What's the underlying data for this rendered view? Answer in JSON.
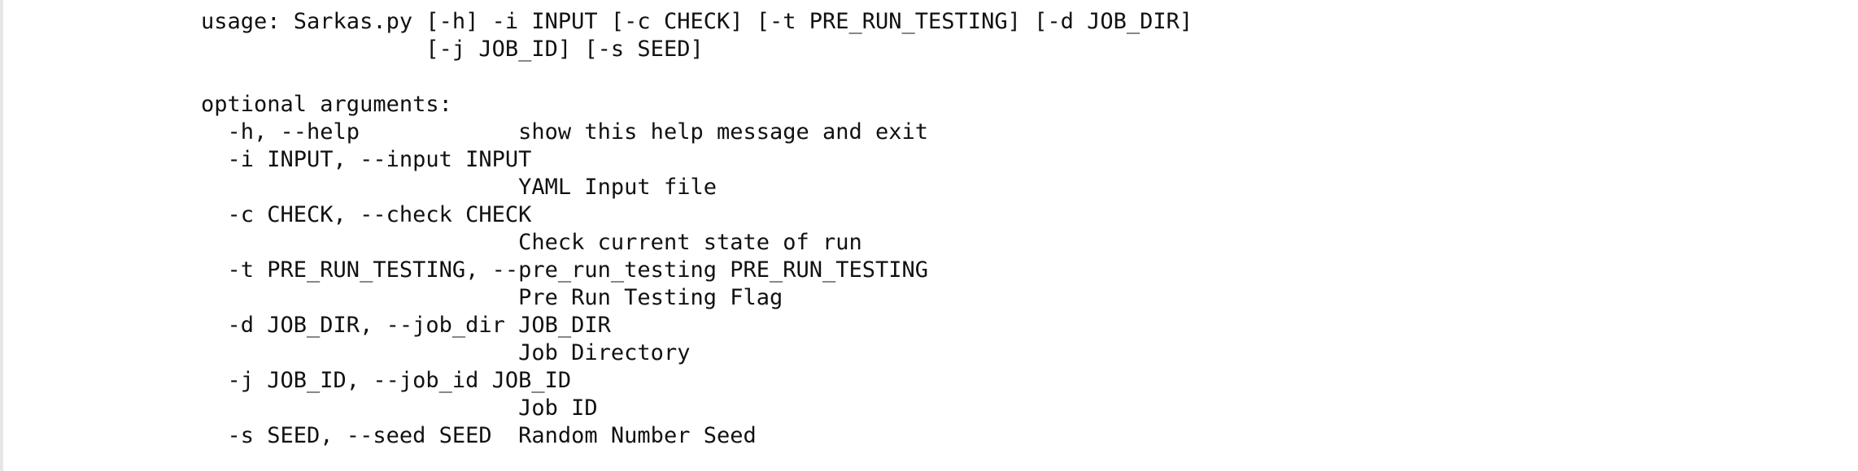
{
  "help": {
    "lines": [
      "usage: Sarkas.py [-h] -i INPUT [-c CHECK] [-t PRE_RUN_TESTING] [-d JOB_DIR]",
      "                 [-j JOB_ID] [-s SEED]",
      "",
      "optional arguments:",
      "  -h, --help            show this help message and exit",
      "  -i INPUT, --input INPUT",
      "                        YAML Input file",
      "  -c CHECK, --check CHECK",
      "                        Check current state of run",
      "  -t PRE_RUN_TESTING, --pre_run_testing PRE_RUN_TESTING",
      "                        Pre Run Testing Flag",
      "  -d JOB_DIR, --job_dir JOB_DIR",
      "                        Job Directory",
      "  -j JOB_ID, --job_id JOB_ID",
      "                        Job ID",
      "  -s SEED, --seed SEED  Random Number Seed"
    ]
  }
}
